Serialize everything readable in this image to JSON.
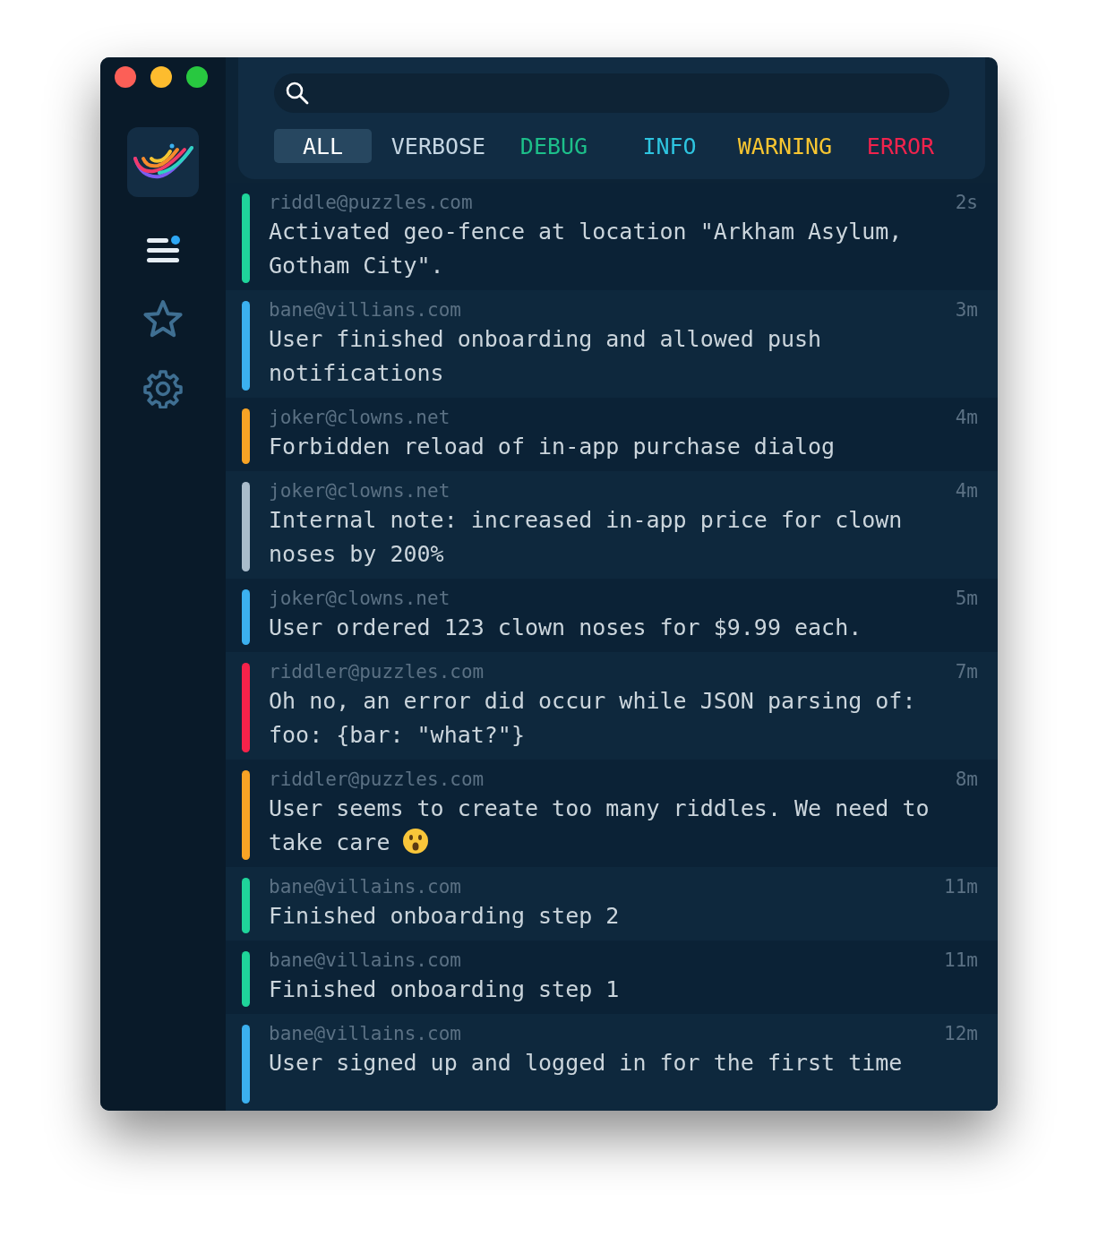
{
  "sidebar": {
    "items": [
      {
        "kind": "list",
        "selected": true,
        "badge": true
      },
      {
        "kind": "star",
        "selected": false,
        "badge": false
      },
      {
        "kind": "settings",
        "selected": false,
        "badge": false
      }
    ]
  },
  "filters": [
    {
      "label": "ALL",
      "selected": true,
      "color": "#ffffff"
    },
    {
      "label": "VERBOSE",
      "selected": false,
      "color": "#c5d6e3"
    },
    {
      "label": "DEBUG",
      "selected": false,
      "color": "#1dbf8a"
    },
    {
      "label": "INFO",
      "selected": false,
      "color": "#2ec5e0"
    },
    {
      "label": "WARNING",
      "selected": false,
      "color": "#f7c531"
    },
    {
      "label": "ERROR",
      "selected": false,
      "color": "#f0234d"
    }
  ],
  "logs": [
    {
      "user": "riddle@puzzles.com",
      "time": "2s",
      "message": "Activated geo-fence at location \"Arkham Asylum, Gotham City\".",
      "color": "#1fd49a"
    },
    {
      "user": "bane@villians.com",
      "time": "3m",
      "message": "User finished onboarding and allowed push notifications",
      "color": "#3bb0ef"
    },
    {
      "user": "joker@clowns.net",
      "time": "4m",
      "message": "Forbidden reload of in-app purchase dialog",
      "color": "#f7a325"
    },
    {
      "user": "joker@clowns.net",
      "time": "4m",
      "message": "Internal note: increased in-app price for clown noses by 200%",
      "color": "#a9bccb"
    },
    {
      "user": "joker@clowns.net",
      "time": "5m",
      "message": "User ordered 123 clown noses for $9.99 each.",
      "color": "#3bb0ef"
    },
    {
      "user": "riddler@puzzles.com",
      "time": "7m",
      "message": "Oh no, an error did occur while JSON parsing of: foo: {bar: \"what?\"}",
      "color": "#f5224a"
    },
    {
      "user": "riddler@puzzles.com",
      "time": "8m",
      "message": "User seems to create too many riddles. We need to take care",
      "color": "#f7a325",
      "reaction": true
    },
    {
      "user": "bane@villains.com",
      "time": "11m",
      "message": "Finished onboarding step 2",
      "color": "#1fd49a"
    },
    {
      "user": "bane@villains.com",
      "time": "11m",
      "message": "Finished onboarding step 1",
      "color": "#1fd49a"
    },
    {
      "user": "bane@villains.com",
      "time": "12m",
      "message": "User signed up and logged in for the first time",
      "color": "#3bb0ef"
    }
  ]
}
